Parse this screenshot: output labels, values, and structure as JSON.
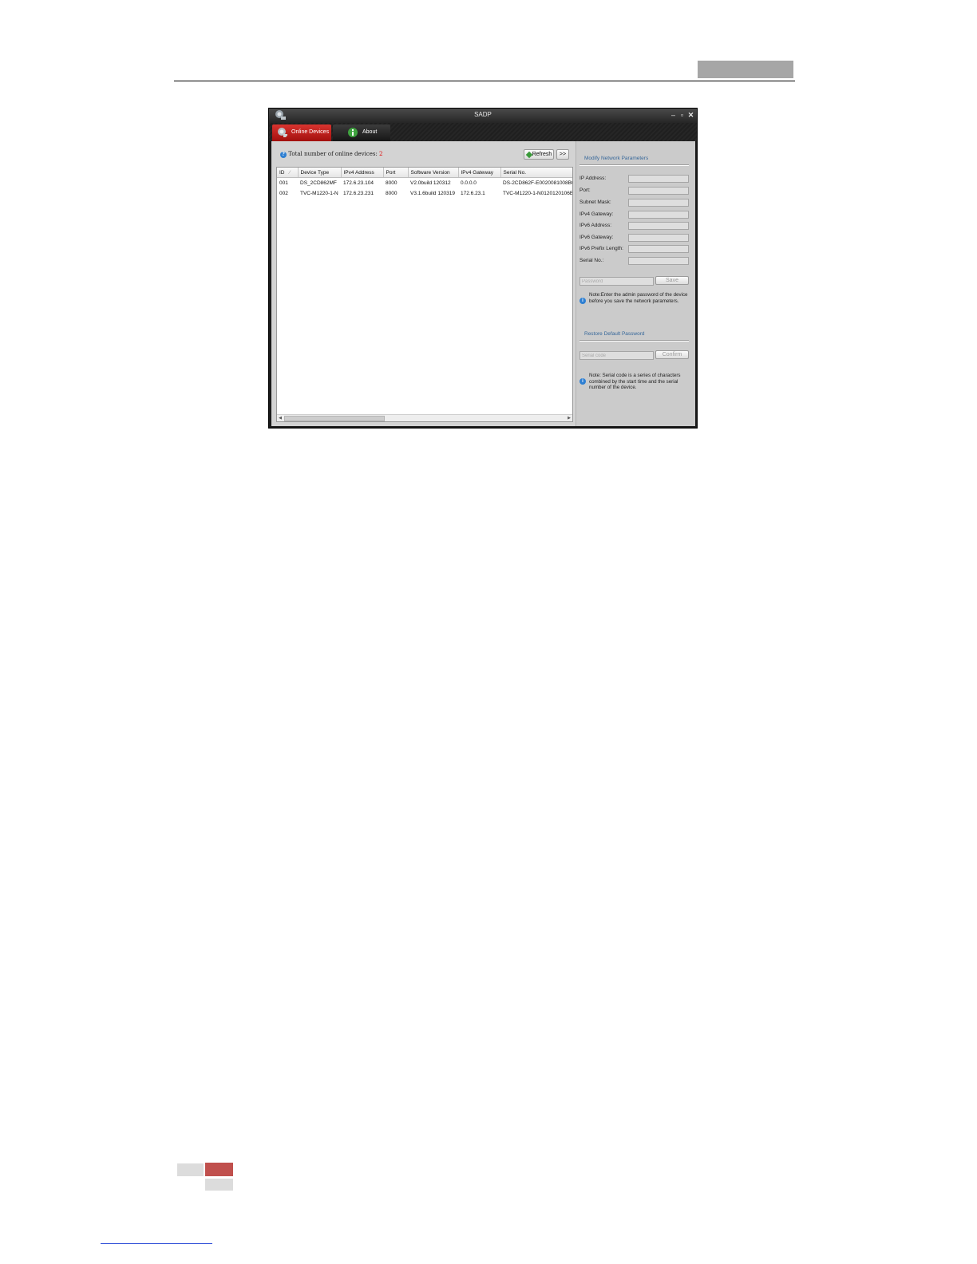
{
  "window": {
    "title": "SADP",
    "controls": {
      "minimize": "–",
      "maximize": "▫",
      "close": "✕"
    }
  },
  "tabs": [
    {
      "label": "Online Devices",
      "active": true
    },
    {
      "label": "About",
      "active": false
    }
  ],
  "toolbar": {
    "total_label": "Total number of online devices:",
    "total_count": "2",
    "refresh_label": "Refresh",
    "expand_label": ">>"
  },
  "table": {
    "columns": [
      "ID",
      "Device Type",
      "IPv4 Address",
      "Port",
      "Software Version",
      "IPv4 Gateway",
      "Serial No."
    ],
    "rows": [
      [
        "001",
        "DS_2CD862MF",
        "172.6.23.104",
        "8000",
        "V2.0build 120312",
        "0.0.0.0",
        "DS-2CD862F-E0020081008B0"
      ],
      [
        "002",
        "TVC-M1220-1-N",
        "172.6.23.231",
        "8000",
        "V3.1.6build 120319",
        "172.6.23.1",
        "TVC-M1220-1-N0120120106B"
      ]
    ]
  },
  "modify_section": {
    "title": "Modify Network Parameters",
    "fields": [
      {
        "label": "IP Address:",
        "value": ""
      },
      {
        "label": "Port:",
        "value": ""
      },
      {
        "label": "Subnet Mask:",
        "value": ""
      },
      {
        "label": "IPv4 Gateway:",
        "value": ""
      },
      {
        "label": "IPv6 Address:",
        "value": ""
      },
      {
        "label": "IPv6 Gateway:",
        "value": ""
      },
      {
        "label": "IPv6 Prefix Length:",
        "value": ""
      },
      {
        "label": "Serial No.:",
        "value": ""
      }
    ],
    "password_placeholder": "Password",
    "save_label": "Save",
    "note": "Note:Enter the admin password of the device before you save the network parameters."
  },
  "restore_section": {
    "title": "Restore Default Password",
    "serial_placeholder": "Serial code",
    "confirm_label": "Confirm",
    "note": "Note: Serial code is a series of characters combined by the start time and the serial number of the device."
  },
  "colors": {
    "active_tab": "#c0201c",
    "accent_text": "#36679a",
    "document_footer": "#c0504d"
  }
}
